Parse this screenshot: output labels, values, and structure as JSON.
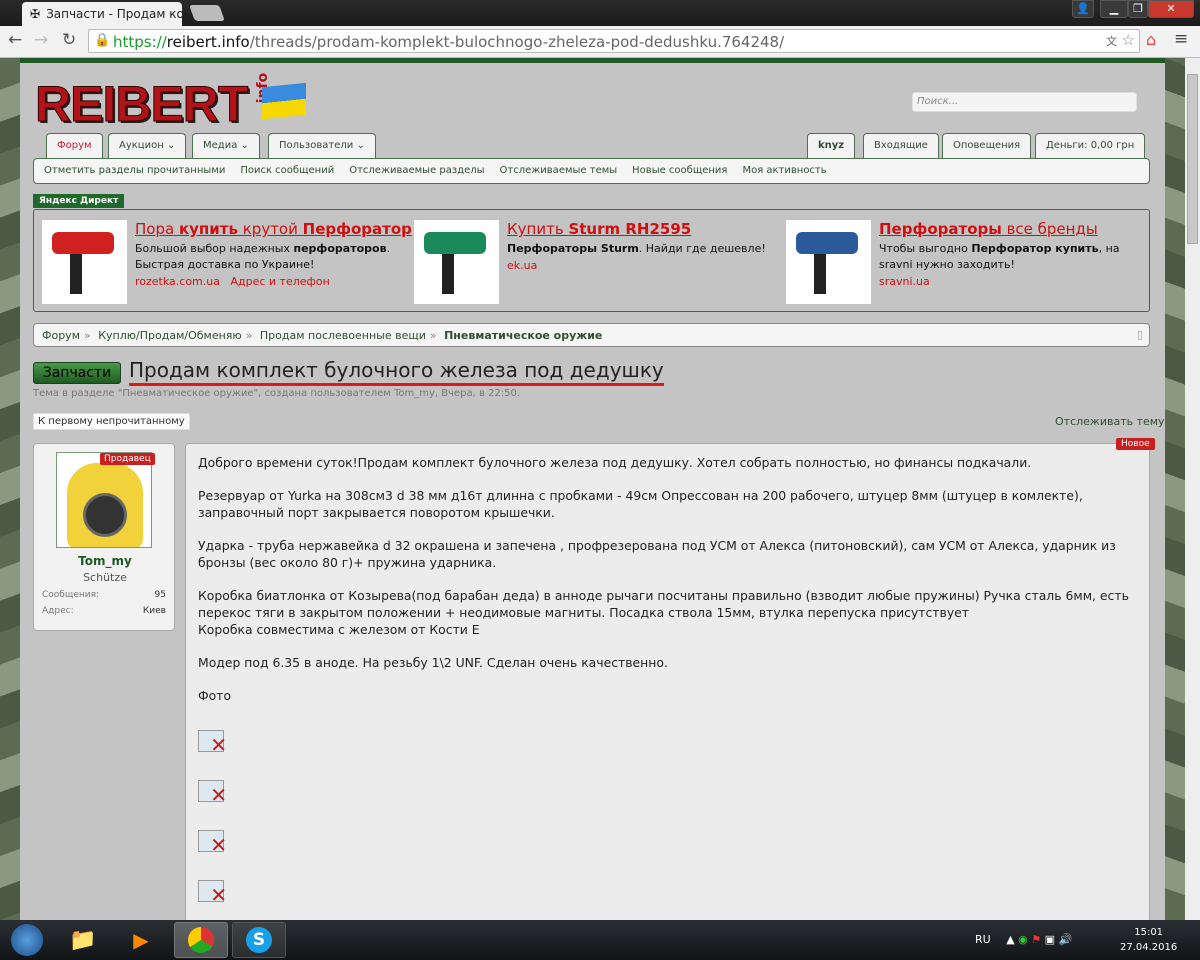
{
  "browser": {
    "tab_title": "Запчасти - Продам компл",
    "url_scheme": "https://",
    "url_host": "reibert.info",
    "url_path": "/threads/prodam-komplekt-bulochnogo-zheleza-pod-dedushku.764248/"
  },
  "site": {
    "logo": "REIBERT",
    "logo_suffix": "info",
    "search_placeholder": "Поиск...",
    "tabs": [
      "Форум",
      "Аукцион",
      "Медиа",
      "Пользователи"
    ],
    "user_tabs": [
      "knyz",
      "Входящие",
      "Оповещения",
      "Деньги: 0,00 грн"
    ],
    "subnav": [
      "Отметить разделы прочитанными",
      "Поиск сообщений",
      "Отслеживаемые разделы",
      "Отслеживаемые темы",
      "Новые сообщения",
      "Моя активность"
    ]
  },
  "ads": {
    "label": "Яндекс Директ",
    "items": [
      {
        "title_pre": "Пора ",
        "title_b1": "купить",
        " title_mid": "",
        "title_mid": " крутой ",
        "title_b2": "Перфоратор",
        "desc_pre": "Большой выбор надежных ",
        "desc_b": "перфораторов",
        "desc_post": ". Быстрая доставка по Украине!",
        "url": "rozetka.com.ua",
        "extra": "Адрес и телефон"
      },
      {
        "title_pre": "Купить ",
        "title_b1": "Sturm RH2595",
        "title_mid": "",
        "title_b2": "",
        "desc_pre": "",
        "desc_b": "Перфораторы Sturm",
        "desc_post": ". Найди где дешевле!",
        "url": "ek.ua",
        "extra": ""
      },
      {
        "title_pre": "",
        "title_b1": "Перфораторы",
        "title_mid": " все бренды",
        "title_b2": "",
        "desc_pre": "Чтобы выгодно ",
        "desc_b": "Перфоратор купить",
        "desc_post": ", на sravni нужно заходить!",
        "url": "sravni.ua",
        "extra": ""
      }
    ]
  },
  "breadcrumb": [
    "Форум",
    "Куплю/Продам/Обменяю",
    "Продам послевоенные вещи",
    "Пневматическое оружие"
  ],
  "thread": {
    "prefix": "Запчасти",
    "title": "Продам комплект булочного железа под дедушку",
    "meta": "Тема в разделе \"Пневматическое оружие\", создана пользователем Tom_my, Вчера, в 22:50.",
    "first_unread": "К первому непрочитанному",
    "watch": "Отслеживать тему"
  },
  "post": {
    "badge_new": "Новое",
    "user": {
      "name": "Tom_my",
      "title": "Schütze",
      "badge": "Продавец",
      "messages_label": "Сообщения:",
      "messages": "95",
      "address_label": "Адрес:",
      "address": "Киев"
    },
    "paragraphs": [
      "Доброго времени суток!Продам комплект булочного железа под дедушку. Хотел собрать полностью, но финансы подкачали.",
      "Резервуар от Yurka на 308см3 d 38 мм д16т длинна с пробками - 49см Опрессован на 200 рабочего, штуцер 8мм (штуцер в комлекте), заправочный порт закрывается поворотом крышечки.",
      "Ударка - труба нержавейка d 32 окрашена и запечена , профрезерована под УСМ от Алекса (питоновский), сам УСМ от Алекса, ударник из бронзы (вес около 80 г)+ пружина ударника.",
      "Коробка биатлонка от Козырева(под барабан деда) в анноде рычаги посчитаны правильно (взводит любые пружины) Ручка сталь 6мм, есть перекос тяги в закрытом положении + неодимовые магниты. Посадка ствола 15мм, втулка перепуска присутствует\nКоробка совместима с железом от Кости Е",
      "Модер под 6.35 в аноде. На резьбу 1\\2 UNF. Сделан очень качественно.",
      "Фото"
    ]
  },
  "taskbar": {
    "lang": "RU",
    "time": "15:01",
    "date": "27.04.2016"
  },
  "colors": {
    "accent_green": "#1f5a25",
    "ad_red": "#d01010",
    "badge_red": "#c82020"
  }
}
